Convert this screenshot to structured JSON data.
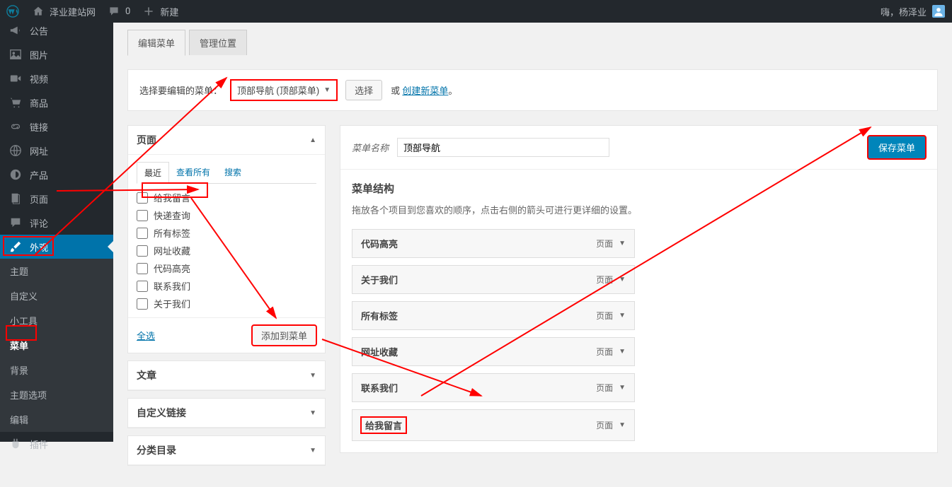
{
  "adminbar": {
    "site_name": "泽业建站网",
    "comments_count": "0",
    "new_label": "新建",
    "greeting": "嗨，杨泽业"
  },
  "sidebar": {
    "items": [
      {
        "icon": "megaphone",
        "label": "公告"
      },
      {
        "icon": "image",
        "label": "图片"
      },
      {
        "icon": "video",
        "label": "视频"
      },
      {
        "icon": "cart",
        "label": "商品"
      },
      {
        "icon": "link",
        "label": "链接"
      },
      {
        "icon": "globe",
        "label": "网址"
      },
      {
        "icon": "product",
        "label": "产品"
      },
      {
        "icon": "page",
        "label": "页面"
      },
      {
        "icon": "comment",
        "label": "评论"
      },
      {
        "icon": "brush",
        "label": "外观"
      },
      {
        "icon": "plugin",
        "label": "插件"
      }
    ],
    "submenu": [
      {
        "label": "主题"
      },
      {
        "label": "自定义"
      },
      {
        "label": "小工具"
      },
      {
        "label": "菜单"
      },
      {
        "label": "背景"
      },
      {
        "label": "主题选项"
      },
      {
        "label": "编辑"
      }
    ]
  },
  "tabs": {
    "t1": "编辑菜单",
    "t2": "管理位置"
  },
  "select_panel": {
    "label": "选择要编辑的菜单：",
    "selected": "顶部导航 (顶部菜单)",
    "select_btn": "选择",
    "or": "或",
    "create_link": "创建新菜单",
    "period": "。"
  },
  "pages_box": {
    "title": "页面",
    "tabs": {
      "recent": "最近",
      "view_all": "查看所有",
      "search": "搜索"
    },
    "items": [
      "给我留言",
      "快递查询",
      "所有标签",
      "网址收藏",
      "代码高亮",
      "联系我们",
      "关于我们"
    ],
    "select_all": "全选",
    "add_btn": "添加到菜单"
  },
  "other_boxes": {
    "posts": "文章",
    "links": "自定义链接",
    "cats": "分类目录"
  },
  "menu_edit": {
    "name_label": "菜单名称",
    "name_value": "顶部导航",
    "save_btn": "保存菜单",
    "structure_title": "菜单结构",
    "structure_desc": "拖放各个项目到您喜欢的顺序，点击右侧的箭头可进行更详细的设置。",
    "type_label": "页面",
    "items": [
      "代码高亮",
      "关于我们",
      "所有标签",
      "网址收藏",
      "联系我们",
      "给我留言"
    ]
  }
}
